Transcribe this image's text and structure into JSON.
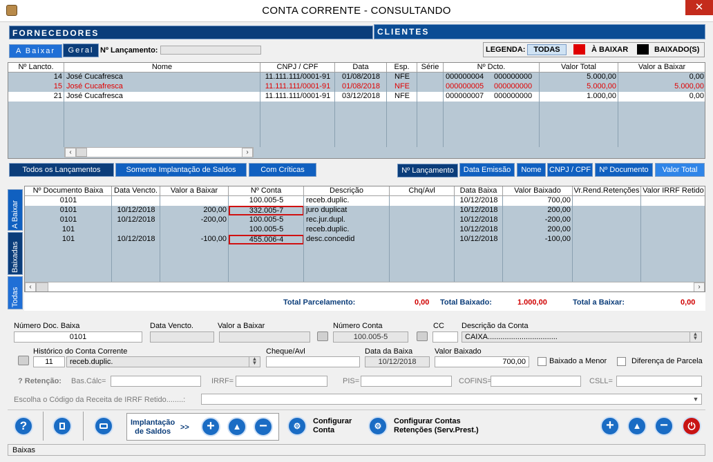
{
  "window": {
    "title": "CONTA CORRENTE - CONSULTANDO",
    "close": "✕"
  },
  "panels": {
    "fornecedores": "FORNECEDORES",
    "clientes": "CLIENTES"
  },
  "subtabs": {
    "a_baixar": "A Baixar",
    "geral": "Geral",
    "lancamento_label": "Nº Lançamento:",
    "lancamento_value": ""
  },
  "legend": {
    "label": "LEGENDA:",
    "todas": "TODAS",
    "a_baixar": "À BAIXAR",
    "baixados": "BAIXADO(S)",
    "red": "#e00000",
    "black": "#000000"
  },
  "top_grid": {
    "headers": [
      "Nº Lancto.",
      "Nome",
      "CNPJ / CPF",
      "Data",
      "Esp.",
      "Série",
      "Nº Dcto.",
      "Valor Total",
      "Valor a Baixar"
    ],
    "rows": [
      {
        "lancto": "14",
        "nome": "José Cucafresca",
        "cnpj": "11.111.111/0001-91",
        "data": "01/08/2018",
        "esp": "NFE",
        "serie": "",
        "dcto1": "000000004",
        "dcto2": "000000000",
        "total": "5.000,00",
        "baixar": "0,00",
        "style": "normal"
      },
      {
        "lancto": "15",
        "nome": "José Cucafresca",
        "cnpj": "11.111.111/0001-91",
        "data": "01/08/2018",
        "esp": "NFE",
        "serie": "",
        "dcto1": "000000005",
        "dcto2": "000000000",
        "total": "5.000,00",
        "baixar": "5.000,00",
        "style": "red"
      },
      {
        "lancto": "21",
        "nome": "José Cucafresca",
        "cnpj": "11.111.111/0001-91",
        "data": "03/12/2018",
        "esp": "NFE",
        "serie": "",
        "dcto1": "000000007",
        "dcto2": "000000000",
        "total": "1.000,00",
        "baixar": "0,00",
        "style": "selected"
      }
    ]
  },
  "filters": {
    "todos": "Todos os Lançamentos",
    "implantacao": "Somente Implantação de Saldos",
    "criticas": "Com Críticas"
  },
  "sorts": {
    "lancamento": "Nº Lançamento",
    "emissao": "Data Emissão",
    "nome": "Nome",
    "cnpj": "CNPJ / CPF",
    "documento": "Nº Documento",
    "valor": "Valor Total"
  },
  "vtabs": {
    "a_baixar": "A Baixar",
    "baixadas": "Baixadas",
    "todas": "Todas"
  },
  "bottom_grid": {
    "headers": [
      "Nº Documento Baixa",
      "Data Vencto.",
      "Valor a Baixar",
      "Nº Conta",
      "Descrição",
      "Chq/Avl",
      "Data Baixa",
      "Valor Baixado",
      "Vr.Rend.Retenções",
      "Valor IRRF Retido"
    ],
    "rows": [
      {
        "doc": "0101",
        "venc": "",
        "vbaixar": "",
        "conta": "100.005-5",
        "desc": "receb.duplic.",
        "chq": "",
        "dbaixa": "10/12/2018",
        "vbaixado": "700,00",
        "highlight": false,
        "selected": true
      },
      {
        "doc": "0101",
        "venc": "10/12/2018",
        "vbaixar": "200,00",
        "conta": "332.005-7",
        "desc": "juro duplicat",
        "chq": "",
        "dbaixa": "10/12/2018",
        "vbaixado": "200,00",
        "highlight": true,
        "selected": false
      },
      {
        "doc": "0101",
        "venc": "10/12/2018",
        "vbaixar": "-200,00",
        "conta": "100.005-5",
        "desc": "rec.jur.dupl.",
        "chq": "",
        "dbaixa": "10/12/2018",
        "vbaixado": "-200,00",
        "highlight": false,
        "selected": false
      },
      {
        "doc": "101",
        "venc": "",
        "vbaixar": "",
        "conta": "100.005-5",
        "desc": "receb.duplic.",
        "chq": "",
        "dbaixa": "10/12/2018",
        "vbaixado": "200,00",
        "highlight": false,
        "selected": false
      },
      {
        "doc": "101",
        "venc": "10/12/2018",
        "vbaixar": "-100,00",
        "conta": "455.006-4",
        "desc": "desc.concedid",
        "chq": "",
        "dbaixa": "10/12/2018",
        "vbaixado": "-100,00",
        "highlight": true,
        "selected": false
      }
    ]
  },
  "totals": {
    "parc_label": "Total Parcelamento:",
    "parc_value": "0,00",
    "baix_label": "Total Baixado:",
    "baix_value": "1.000,00",
    "abaixar_label": "Total a Baixar:",
    "abaixar_value": "0,00"
  },
  "form": {
    "num_doc_label": "Número Doc. Baixa",
    "num_doc": "0101",
    "venc_label": "Data Vencto.",
    "venc": "",
    "vbaixar_label": "Valor a Baixar",
    "vbaixar": "",
    "num_conta_label": "Número Conta",
    "num_conta": "100.005-5",
    "cc_label": "CC",
    "cc": "",
    "desc_conta_label": "Descrição da Conta",
    "desc_conta": "CAIXA.................................",
    "hist_label": "Histórico do Conta Corrente",
    "hist_code": "11",
    "hist_text": "receb.duplic.",
    "cheque_label": "Cheque/Avl",
    "cheque": "",
    "data_baixa_label": "Data da Baixa",
    "data_baixa": "10/12/2018",
    "vbaixado_label": "Valor Baixado",
    "vbaixado": "700,00",
    "baixado_menor": "Baixado a Menor",
    "dif_parcela": "Diferença de Parcela",
    "retencao_label": "? Retenção:",
    "bascalc": "Bas.Cálc=",
    "irrf": "IRRF=",
    "pis": "PIS=",
    "cofins": "COFINS=",
    "csll": "CSLL=",
    "irrf_code_label": "Escolha o Código da Receita de IRRF Retido........:"
  },
  "toolbar": {
    "help": "?",
    "implantacao": "Implantação\nde Saldos",
    "arrows": ">>",
    "config_conta": "Configurar\nConta",
    "config_ret": "Configurar Contas\nRetenções (Serv.Prest.)",
    "plus": "+",
    "up": "▲",
    "minus": "−",
    "power": "⏻"
  },
  "status": {
    "text": "Baixas"
  }
}
